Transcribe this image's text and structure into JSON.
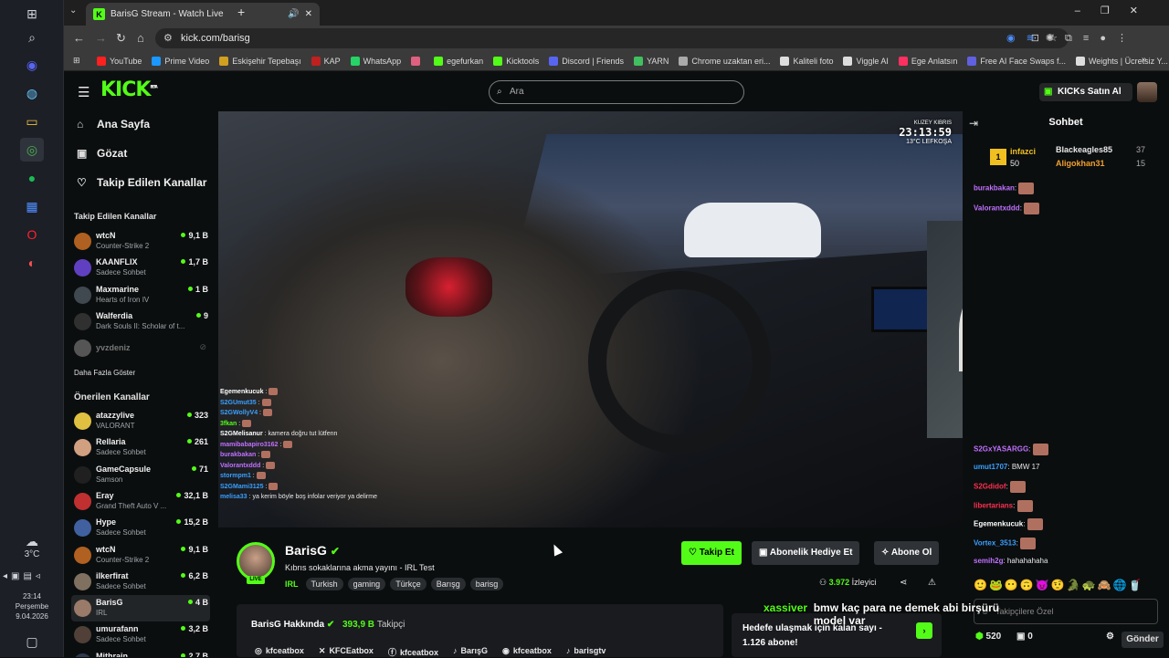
{
  "browser": {
    "tab_title": "BarisG Stream - Watch Live",
    "url": "kick.com/barisg",
    "bookmarks": [
      {
        "label": "YouTube",
        "color": "#ff2020"
      },
      {
        "label": "Prime Video",
        "color": "#1a98ff"
      },
      {
        "label": "Eskişehir Tepebaşı",
        "color": "#d0a020"
      },
      {
        "label": "KAP",
        "color": "#c02020"
      },
      {
        "label": "WhatsApp",
        "color": "#25d366"
      },
      {
        "label": "",
        "color": "#e06080"
      },
      {
        "label": "egefurkan",
        "color": "#53fc18"
      },
      {
        "label": "Kicktools",
        "color": "#53fc18"
      },
      {
        "label": "Discord | Friends",
        "color": "#5865f2"
      },
      {
        "label": "YARN",
        "color": "#40c060"
      },
      {
        "label": "Chrome uzaktan eri...",
        "color": "#aaaaaa"
      },
      {
        "label": "Kaliteli foto",
        "color": "#dddddd"
      },
      {
        "label": "Viggle AI",
        "color": "#dddddd"
      },
      {
        "label": "Ege Anlatsın",
        "color": "#ff3060"
      },
      {
        "label": "Free AI Face Swaps f...",
        "color": "#6060e0"
      },
      {
        "label": "Weights | Ücretsiz Y...",
        "color": "#dddddd"
      }
    ]
  },
  "taskbar": {
    "weather_temp": "3°C",
    "time": "23:14",
    "day": "Perşembe",
    "date": "9.04.2026"
  },
  "header": {
    "logo": "KICK",
    "logo_beta": "BETA",
    "search_placeholder": "Ara",
    "buy_kicks": "KICKs Satın Al"
  },
  "sidebar": {
    "nav": [
      "Ana Sayfa",
      "Gözat",
      "Takip Edilen Kanallar"
    ],
    "followed_title": "Takip Edilen Kanallar",
    "followed": [
      {
        "name": "wtcN",
        "game": "Counter-Strike 2",
        "viewers": "9,1 B",
        "color": "#b06020"
      },
      {
        "name": "KAANFLIX",
        "game": "Sadece Sohbet",
        "viewers": "1,7 B",
        "color": "#6040c0"
      },
      {
        "name": "Maxmarine",
        "game": "Hearts of Iron IV",
        "viewers": "1 B",
        "color": "#404850"
      },
      {
        "name": "Walferdia",
        "game": "Dark Souls II: Scholar of t...",
        "viewers": "9",
        "color": "#303030"
      }
    ],
    "offline_channel": "yvzdeniz",
    "more": "Daha Fazla Göster",
    "recommended_title": "Önerilen Kanallar",
    "recommended": [
      {
        "name": "atazzylive",
        "game": "VALORANT",
        "viewers": "323",
        "color": "#e0c040"
      },
      {
        "name": "Rellaria",
        "game": "Sadece Sohbet",
        "viewers": "261",
        "color": "#d0a080"
      },
      {
        "name": "GameCapsule",
        "game": "Samson",
        "viewers": "71",
        "color": "#202020"
      },
      {
        "name": "Eray",
        "game": "Grand Theft Auto V ...",
        "viewers": "32,1 B",
        "color": "#c03030"
      },
      {
        "name": "Hype",
        "game": "Sadece Sohbet",
        "viewers": "15,2 B",
        "color": "#4060a0"
      },
      {
        "name": "wtcN",
        "game": "Counter-Strike 2",
        "viewers": "9,1 B",
        "color": "#b06020"
      },
      {
        "name": "ilkerfirat",
        "game": "Sadece Sohbet",
        "viewers": "6,2 B",
        "color": "#807060"
      },
      {
        "name": "BarisG",
        "game": "IRL",
        "viewers": "4 B",
        "color": "#9a7a68"
      },
      {
        "name": "umurafann",
        "game": "Sadece Sohbet",
        "viewers": "3,2 B",
        "color": "#504038"
      },
      {
        "name": "Mithrain",
        "game": "",
        "viewers": "2,7 B",
        "color": "#303850"
      }
    ]
  },
  "player": {
    "osd_location": "KUZEY KIBRIS",
    "osd_time": "23:13:59",
    "osd_temp": "13°C  LEFKOŞA",
    "overlay_chat": [
      {
        "user": "Egemenkucuk",
        "msg": "",
        "color": "#ffffff"
      },
      {
        "user": "S2GUmut35",
        "msg": "",
        "color": "#3aa0ff"
      },
      {
        "user": "S2GWollyV4",
        "msg": "",
        "color": "#3aa0ff"
      },
      {
        "user": "3fkan",
        "msg": "",
        "color": "#53fc18"
      },
      {
        "user": "S2GMelisanur",
        "msg": "kamera doğru tut lütfenn",
        "color": "#ffffff"
      },
      {
        "user": "mamibabapiro3162",
        "msg": "",
        "color": "#c070ff"
      },
      {
        "user": "burakbakan",
        "msg": "",
        "color": "#c070ff"
      },
      {
        "user": "Valorantxddd",
        "msg": "",
        "color": "#c070ff"
      },
      {
        "user": "stormpm1",
        "msg": "",
        "color": "#3aa0ff"
      },
      {
        "user": "S2GMami3125",
        "msg": "",
        "color": "#3aa0ff"
      },
      {
        "user": "melisa33",
        "msg": "ya kerim böyle boş infolar veriyor ya delirme",
        "color": "#3aa0ff"
      }
    ]
  },
  "stream": {
    "name": "BarisG",
    "live_badge": "LIVE",
    "title": "Kıbrıs sokaklarına akma yayını - IRL Test",
    "category": "IRL",
    "tags": [
      "Turkish",
      "gaming",
      "Türkçe",
      "Barışg",
      "barisg"
    ],
    "follow": "Takip Et",
    "gift_sub": "Abonelik Hediye Et",
    "subscribe": "Abone Ol",
    "viewers_count": "3.972",
    "viewers_label": "İzleyici",
    "about_title": "BarisG Hakkında",
    "followers_count": "393,9 B",
    "followers_label": "Takipçi",
    "socials": [
      "kfceatbox",
      "KFCEatbox",
      "kfceatbox",
      "BarışG",
      "kfceatbox",
      "barisgtv"
    ],
    "goal_text": "Hedefe ulaşmak için kalan sayı - 1.126 abone!",
    "floating_chat_user": "xassiver",
    "floating_chat_msg": "bmw kaç para ne demek abi birşürü model var"
  },
  "chat": {
    "title": "Sohbet",
    "top": [
      {
        "rank": "1",
        "name": "infazci",
        "value": "50"
      },
      {
        "name": "Blackeagles85",
        "value": "37"
      },
      {
        "name": "Aligokhan31",
        "value": "15"
      }
    ],
    "messages_top": [
      {
        "user": "burakbakan",
        "msg": "",
        "color": "#c070ff"
      },
      {
        "user": "Valorantxddd",
        "msg": "",
        "color": "#c070ff"
      }
    ],
    "messages": [
      {
        "user": "S2GxYASARGG",
        "msg": "",
        "color": "#c070ff"
      },
      {
        "user": "umut1707",
        "msg": "BMW 17",
        "color": "#3aa0ff"
      },
      {
        "user": "S2Gdidof",
        "msg": "",
        "color": "#ff3050"
      },
      {
        "user": "libertarians",
        "msg": "",
        "color": "#ff3050"
      },
      {
        "user": "Egemenkucuk",
        "msg": "",
        "color": "#ffffff"
      },
      {
        "user": "Vortex_3513",
        "msg": "",
        "color": "#3aa0ff"
      },
      {
        "user": "semih2g",
        "msg": "hahahahaha",
        "color": "#c070ff"
      }
    ],
    "input_placeholder": "Takipçilere Özel",
    "kicks": "520",
    "gifts": "0",
    "send": "Gönder"
  }
}
